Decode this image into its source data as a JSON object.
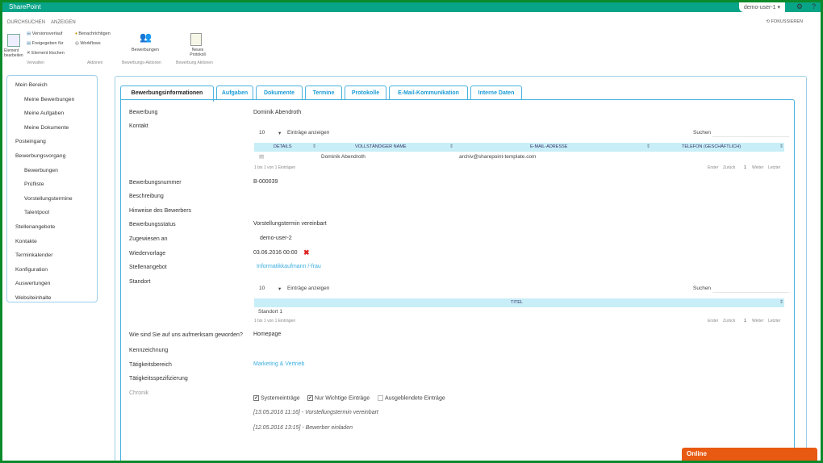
{
  "app": {
    "brand": "SharePoint",
    "user": "demo-user-1 ▾",
    "settings_icon": "gear-icon",
    "help_icon": "help-icon"
  },
  "ribbon": {
    "tabs": [
      "DURCHSUCHEN",
      "ANZEIGEN"
    ],
    "focus": "FOKUSSIEREN",
    "edit_item": "Element bearbeiten",
    "small1": [
      "Versionsverlauf",
      "Freigegeben für",
      "Element löschen"
    ],
    "small2": [
      "Benachrichtigen",
      "Workflows"
    ],
    "big1": "Bewerbungen",
    "big2": "Neues Protokoll",
    "groups": [
      "Verwalten",
      "Aktionen",
      "Bewerbungs-Aktionen",
      "Bewerbung Aktionen"
    ]
  },
  "nav": [
    {
      "label": "Mein Bereich",
      "sub": false
    },
    {
      "label": "Meine Bewerbungen",
      "sub": true
    },
    {
      "label": "Meine Aufgaben",
      "sub": true
    },
    {
      "label": "Meine Dokumente",
      "sub": true
    },
    {
      "label": "Posteingang",
      "sub": false
    },
    {
      "label": "Bewerbungsvorgang",
      "sub": false
    },
    {
      "label": "Bewerbungen",
      "sub": true
    },
    {
      "label": "Prüfliste",
      "sub": true
    },
    {
      "label": "Vorstellungstermine",
      "sub": true
    },
    {
      "label": "Talentpool",
      "sub": true
    },
    {
      "label": "Stellenangebote",
      "sub": false
    },
    {
      "label": "Kontakte",
      "sub": false
    },
    {
      "label": "Terminkalender",
      "sub": false
    },
    {
      "label": "Konfiguration",
      "sub": false
    },
    {
      "label": "Auswertungen",
      "sub": false
    },
    {
      "label": "Websiteinhalte",
      "sub": false
    }
  ],
  "tabs": [
    "Bewerbungsinformationen",
    "Aufgaben",
    "Dokumente",
    "Termine",
    "Protokolle",
    "E-Mail-Kommunikation",
    "Interne Daten"
  ],
  "fields": {
    "bewerbung": {
      "label": "Bewerbung",
      "value": "Dominik Abendroth"
    },
    "kontakt": {
      "label": "Kontakt"
    },
    "nummer": {
      "label": "Bewerbungsnummer",
      "value": "B-000039"
    },
    "beschreibung": {
      "label": "Beschreibung"
    },
    "hinweise": {
      "label": "Hinweise des Bewerbers"
    },
    "status": {
      "label": "Bewerbungsstatus",
      "value": "Vorstellungstermin vereinbart"
    },
    "zugewiesen": {
      "label": "Zugewiesen an",
      "value": "demo-user-2"
    },
    "wiedervorlage": {
      "label": "Wiedervorlage",
      "value": "03.06.2016 00:00"
    },
    "stellenangebot": {
      "label": "Stellenangebot",
      "value": "Informatikkaufmann /-frau"
    },
    "standort": {
      "label": "Standort"
    },
    "aufmerksam": {
      "label": "Wie sind Sie auf uns aufmerksam geworden?",
      "value": "Homepage"
    },
    "kennzeichnung": {
      "label": "Kennzeichnung"
    },
    "taetigkeitsbereich": {
      "label": "Tätigkeitsbereich",
      "value": "Marketing & Vertrieb"
    },
    "taetigkeitsspez": {
      "label": "Tätigkeitsspezifizierung"
    },
    "chronik": {
      "label": "Chronik"
    }
  },
  "contact_table": {
    "entries": "10",
    "entries_label": "Einträge anzeigen",
    "search": "Suchen",
    "columns": [
      "DETAILS",
      "VOLLSTÄNDIGER NAME",
      "E-MAIL-ADRESSE",
      "TELEFON (GESCHÄFTLICH)"
    ],
    "row": {
      "name": "Dominik Abendroth",
      "email": "archiv@sharepoint-template.com"
    },
    "info": "1 bis 1 von 1 Einträgen",
    "pager": [
      "Erster",
      "Zurück",
      "1",
      "Weiter",
      "Letzter"
    ]
  },
  "location_table": {
    "entries": "10",
    "entries_label": "Einträge anzeigen",
    "search": "Suchen",
    "columns": [
      "TITEL"
    ],
    "row": {
      "title": "Standort 1"
    },
    "info": "1 bis 1 von 1 Einträgen",
    "pager": [
      "Erster",
      "Zurück",
      "1",
      "Weiter",
      "Letzter"
    ]
  },
  "chronik": {
    "filters": [
      {
        "label": "Systemeinträge",
        "checked": true
      },
      {
        "label": "Nur Wichtige Einträge",
        "checked": true
      },
      {
        "label": "Ausgeblendete Einträge",
        "checked": false
      }
    ],
    "entries": [
      "[13.05.2016 11:16] - Vorstellungstermin vereinbart",
      "[12.05.2016 13:15] - Bewerber einladen"
    ]
  },
  "online": "Online",
  "colors": {
    "accent": "#1a9bd7",
    "brand": "#08a488",
    "online": "#e85a12",
    "border": "#9ccfe8"
  }
}
